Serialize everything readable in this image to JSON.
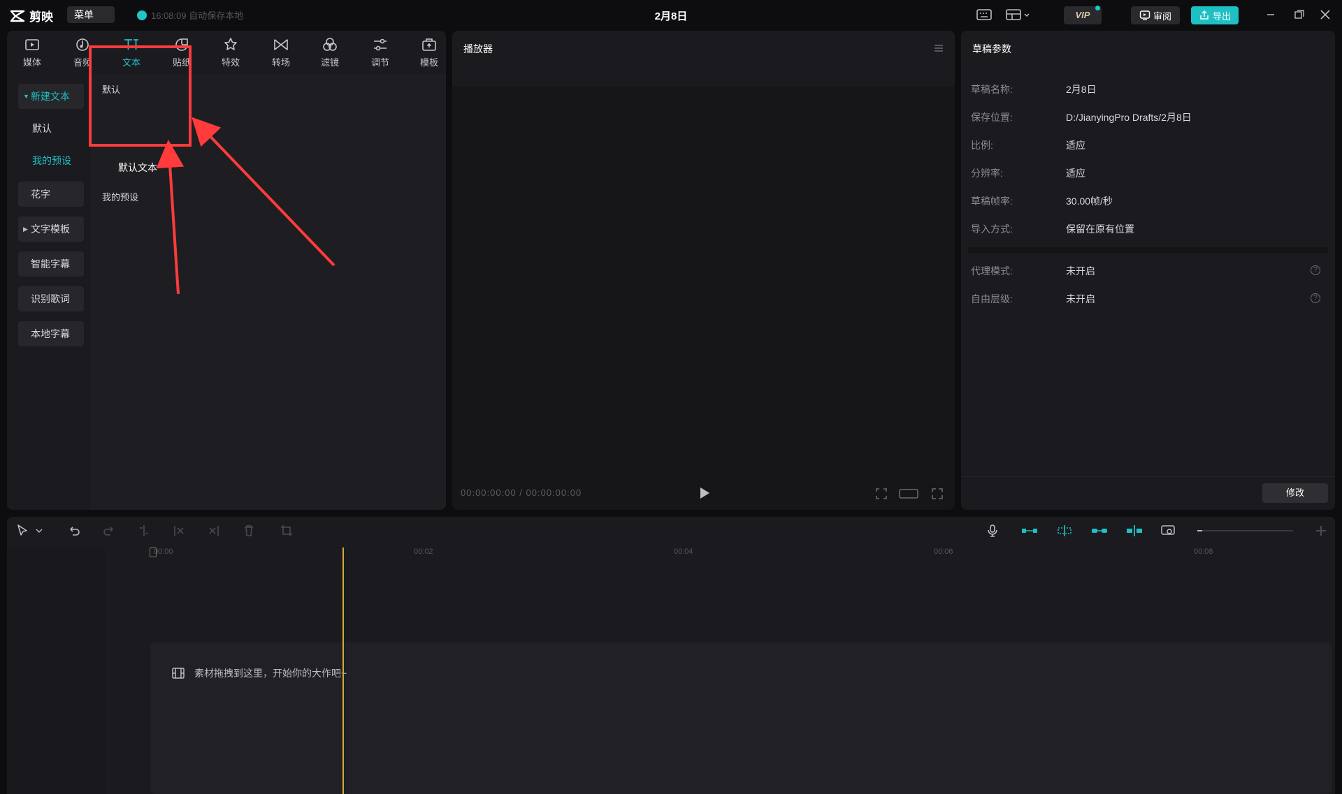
{
  "titlebar": {
    "app_name": "剪映",
    "menu_label": "菜单",
    "autosave_text": "16:08:09 自动保存本地",
    "window_title": "2月8日",
    "vip_label": "VIP",
    "review_label": "审阅",
    "export_label": "导出"
  },
  "toolbar": [
    {
      "label": "媒体",
      "icon": "media-icon"
    },
    {
      "label": "音频",
      "icon": "audio-icon"
    },
    {
      "label": "文本",
      "icon": "text-icon",
      "active": true
    },
    {
      "label": "贴纸",
      "icon": "sticker-icon"
    },
    {
      "label": "特效",
      "icon": "effects-icon"
    },
    {
      "label": "转场",
      "icon": "transition-icon"
    },
    {
      "label": "滤镜",
      "icon": "filter-icon"
    },
    {
      "label": "调节",
      "icon": "adjust-icon"
    },
    {
      "label": "模板",
      "icon": "template-icon"
    }
  ],
  "sidebar": {
    "new_text": "新建文本",
    "default": "默认",
    "my_presets": "我的预设",
    "fancy_text": "花字",
    "text_templates": "文字模板",
    "smart_captions": "智能字幕",
    "recognize_lyrics": "识别歌词",
    "local_captions": "本地字幕"
  },
  "content": {
    "section_default": "默认",
    "default_text_card": "默认文本",
    "section_my_presets": "我的预设"
  },
  "player": {
    "title": "播放器",
    "timecode": "00:00:00:00 / 00:00:00:00"
  },
  "draft": {
    "title": "草稿参数",
    "rows": [
      {
        "k": "草稿名称:",
        "v": "2月8日"
      },
      {
        "k": "保存位置:",
        "v": "D:/JianyingPro Drafts/2月8日"
      },
      {
        "k": "比例:",
        "v": "适应"
      },
      {
        "k": "分辨率:",
        "v": "适应"
      },
      {
        "k": "草稿帧率:",
        "v": "30.00帧/秒"
      },
      {
        "k": "导入方式:",
        "v": "保留在原有位置"
      }
    ],
    "rows2": [
      {
        "k": "代理模式:",
        "v": "未开启"
      },
      {
        "k": "自由层级:",
        "v": "未开启"
      }
    ],
    "modify_label": "修改"
  },
  "timeline": {
    "ticks": [
      "00:00",
      "00:02",
      "00:04",
      "00:06",
      "00:08"
    ],
    "drop_hint": "素材拖拽到这里，开始你的大作吧~"
  },
  "colors": {
    "accent": "#1fc0c4",
    "annotation": "#ff3b3b",
    "playhead": "#d9a832"
  }
}
